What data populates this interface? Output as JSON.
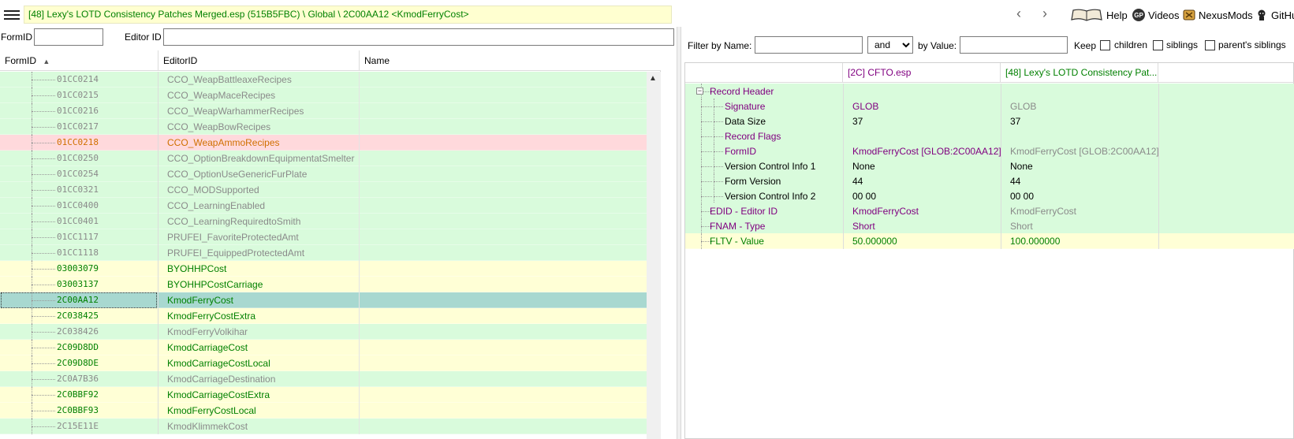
{
  "topbar": {
    "path": "[48] Lexy's LOTD Consistency Patches Merged.esp (515B5FBC) \\ Global \\ 2C00AA12 <KmodFerryCost>",
    "help_label": "Help",
    "videos_label": "Videos",
    "nexusmods_label": "NexusMods",
    "github_label": "GitHu"
  },
  "left_filter": {
    "formid_label": "FormID",
    "formid_value": "",
    "editorid_label": "Editor ID",
    "editorid_value": ""
  },
  "left_grid": {
    "columns": [
      "FormID",
      "EditorID",
      "Name"
    ],
    "rows": [
      {
        "formid": "01CC0214",
        "editorid": "CCO_WeapBattleaxeRecipes",
        "bg": "green",
        "color": "gray"
      },
      {
        "formid": "01CC0215",
        "editorid": "CCO_WeapMaceRecipes",
        "bg": "green",
        "color": "gray"
      },
      {
        "formid": "01CC0216",
        "editorid": "CCO_WeapWarhammerRecipes",
        "bg": "green",
        "color": "gray"
      },
      {
        "formid": "01CC0217",
        "editorid": "CCO_WeapBowRecipes",
        "bg": "green",
        "color": "gray"
      },
      {
        "formid": "01CC0218",
        "editorid": "CCO_WeapAmmoRecipes",
        "bg": "red",
        "color": "orange"
      },
      {
        "formid": "01CC0250",
        "editorid": "CCO_OptionBreakdownEquipmentatSmelter",
        "bg": "green",
        "color": "gray"
      },
      {
        "formid": "01CC0254",
        "editorid": "CCO_OptionUseGenericFurPlate",
        "bg": "green",
        "color": "gray"
      },
      {
        "formid": "01CC0321",
        "editorid": "CCO_MODSupported",
        "bg": "green",
        "color": "gray"
      },
      {
        "formid": "01CC0400",
        "editorid": "CCO_LearningEnabled",
        "bg": "green",
        "color": "gray"
      },
      {
        "formid": "01CC0401",
        "editorid": "CCO_LearningRequiredtoSmith",
        "bg": "green",
        "color": "gray"
      },
      {
        "formid": "01CC1117",
        "editorid": "PRUFEI_FavoriteProtectedAmt",
        "bg": "green",
        "color": "gray"
      },
      {
        "formid": "01CC1118",
        "editorid": "PRUFEI_EquippedProtectedAmt",
        "bg": "green",
        "color": "gray"
      },
      {
        "formid": "03003079",
        "editorid": "BYOHHPCost",
        "bg": "yellow",
        "color": "green"
      },
      {
        "formid": "03003137",
        "editorid": "BYOHHPCostCarriage",
        "bg": "yellow",
        "color": "green"
      },
      {
        "formid": "2C00AA12",
        "editorid": "KmodFerryCost",
        "bg": "sel",
        "color": "green"
      },
      {
        "formid": "2C038425",
        "editorid": "KmodFerryCostExtra",
        "bg": "yellow",
        "color": "green"
      },
      {
        "formid": "2C038426",
        "editorid": "KmodFerryVolkihar",
        "bg": "green",
        "color": "gray"
      },
      {
        "formid": "2C09D8DD",
        "editorid": "KmodCarriageCost",
        "bg": "yellow",
        "color": "green"
      },
      {
        "formid": "2C09D8DE",
        "editorid": "KmodCarriageCostLocal",
        "bg": "yellow",
        "color": "green"
      },
      {
        "formid": "2C0A7B36",
        "editorid": "KmodCarriageDestination",
        "bg": "green",
        "color": "gray"
      },
      {
        "formid": "2C0BBF92",
        "editorid": "KmodCarriageCostExtra",
        "bg": "yellow",
        "color": "green"
      },
      {
        "formid": "2C0BBF93",
        "editorid": "KmodFerryCostLocal",
        "bg": "yellow",
        "color": "green"
      },
      {
        "formid": "2C15E11E",
        "editorid": "KmodKlimmekCost",
        "bg": "green",
        "color": "gray"
      }
    ]
  },
  "right_filter": {
    "name_label": "Filter by Name:",
    "name_value": "",
    "op_value": "and",
    "value_label": "by Value:",
    "value_value": "",
    "keep_label": "Keep",
    "children_label": "children",
    "siblings_label": "siblings",
    "parents_label": "parent's siblings"
  },
  "right_grid": {
    "col1": "[2C] CFTO.esp",
    "col2": "[48] Lexy's LOTD Consistency Pat...",
    "rows": [
      {
        "label": "Record Header",
        "v1": "",
        "v2": "",
        "level": 0,
        "bg": "green",
        "lc": "purple",
        "c1": "purple",
        "c2": "graytxt",
        "expander": true
      },
      {
        "label": "Signature",
        "v1": "GLOB",
        "v2": "GLOB",
        "level": 1,
        "bg": "green",
        "lc": "purple",
        "c1": "purple",
        "c2": "graytxt"
      },
      {
        "label": "Data Size",
        "v1": "37",
        "v2": "37",
        "level": 1,
        "bg": "green",
        "lc": "black",
        "c1": "black",
        "c2": "black"
      },
      {
        "label": "Record Flags",
        "v1": "",
        "v2": "",
        "level": 1,
        "bg": "green",
        "lc": "purple",
        "c1": "purple",
        "c2": "graytxt"
      },
      {
        "label": "FormID",
        "v1": "KmodFerryCost [GLOB:2C00AA12]",
        "v2": "KmodFerryCost [GLOB:2C00AA12]",
        "level": 1,
        "bg": "green",
        "lc": "purple",
        "c1": "purple",
        "c2": "graytxt"
      },
      {
        "label": "Version Control Info 1",
        "v1": "None",
        "v2": "None",
        "level": 1,
        "bg": "green",
        "lc": "black",
        "c1": "black",
        "c2": "black"
      },
      {
        "label": "Form Version",
        "v1": "44",
        "v2": "44",
        "level": 1,
        "bg": "green",
        "lc": "black",
        "c1": "black",
        "c2": "black"
      },
      {
        "label": "Version Control Info 2",
        "v1": "00 00",
        "v2": "00 00",
        "level": 1,
        "bg": "green",
        "lc": "black",
        "c1": "black",
        "c2": "black"
      },
      {
        "label": "EDID - Editor ID",
        "v1": "KmodFerryCost",
        "v2": "KmodFerryCost",
        "level": 0,
        "bg": "green",
        "lc": "purple",
        "c1": "purple",
        "c2": "graytxt"
      },
      {
        "label": "FNAM - Type",
        "v1": "Short",
        "v2": "Short",
        "level": 0,
        "bg": "green",
        "lc": "purple",
        "c1": "purple",
        "c2": "graytxt"
      },
      {
        "label": "FLTV - Value",
        "v1": "50.000000",
        "v2": "100.000000",
        "level": 0,
        "bg": "yellow",
        "lc": "green2",
        "c1": "green2",
        "c2": "green2"
      }
    ]
  }
}
